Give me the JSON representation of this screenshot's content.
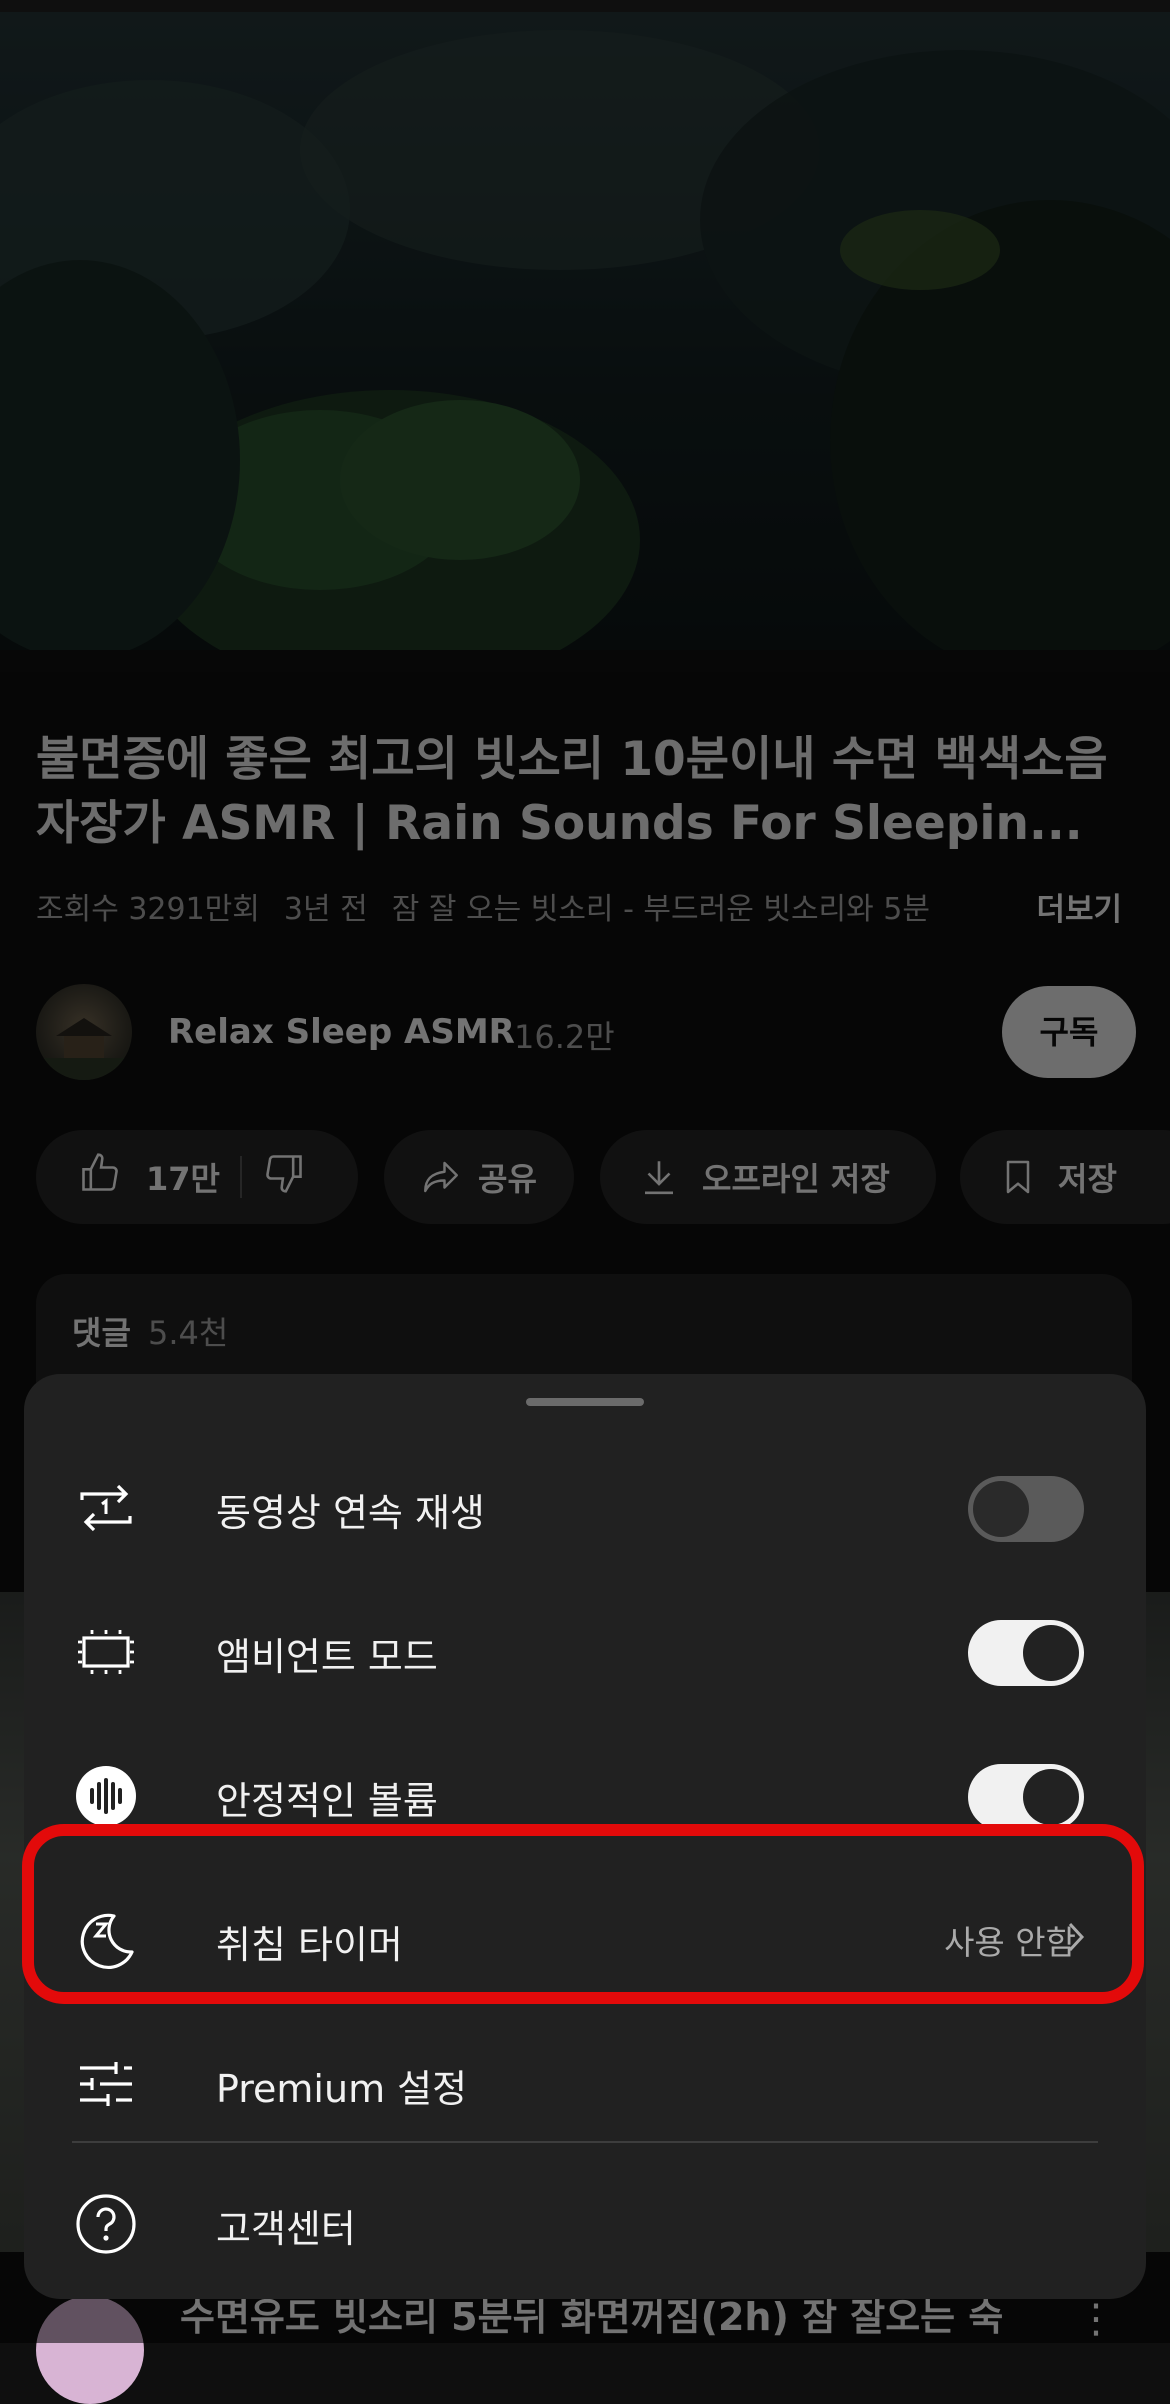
{
  "video": {
    "title": "불면증에 좋은 최고의 빗소리 10분이내 수면 백색소음 자장가 ASMR | Rain Sounds For Sleepin...",
    "views": "조회수 3291만회",
    "age": "3년 전",
    "description_snippet": "잠 잘 오는 빗소리 - 부드러운 빗소리와 5분",
    "more_label": "더보기"
  },
  "channel": {
    "name": "Relax Sleep ASMR",
    "subscribers": "16.2만",
    "subscribe_label": "구독"
  },
  "actions": {
    "likes": "17만",
    "share_label": "공유",
    "download_label": "오프라인 저장",
    "save_label": "저장"
  },
  "comments": {
    "label": "댓글",
    "count": "5.4천"
  },
  "next_video": {
    "title": "수면유도 빗소리 5분뒤 화면꺼짐(2h) 잠 잘오는 숙"
  },
  "settings_sheet": {
    "items": [
      {
        "label": "동영상 연속 재생",
        "icon": "repeat-one-icon",
        "toggle": "off"
      },
      {
        "label": "앰비언트 모드",
        "icon": "ambient-tv-icon",
        "toggle": "on"
      },
      {
        "label": "안정적인 볼륨",
        "icon": "stable-volume-icon",
        "toggle": "on"
      },
      {
        "label": "취침 타이머",
        "icon": "moon-sleep-icon",
        "value": "사용 안함"
      },
      {
        "label": "Premium 설정",
        "icon": "sliders-icon"
      },
      {
        "label": "고객센터",
        "icon": "help-icon"
      }
    ]
  },
  "colors": {
    "highlight": "#e30a0a",
    "sheet_bg": "#212121",
    "page_bg": "#0f0f0f"
  }
}
